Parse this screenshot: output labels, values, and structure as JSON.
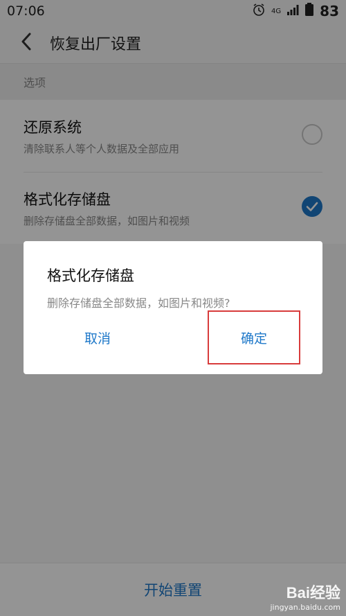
{
  "status_bar": {
    "time": "07:06",
    "network": "4G",
    "battery": "83"
  },
  "header": {
    "title": "恢复出厂设置"
  },
  "section": {
    "label": "选项"
  },
  "options": [
    {
      "title": "还原系统",
      "subtitle": "清除联系人等个人数据及全部应用",
      "checked": false
    },
    {
      "title": "格式化存储盘",
      "subtitle": "删除存储盘全部数据，如图片和视频",
      "checked": true
    }
  ],
  "dialog": {
    "title": "格式化存储盘",
    "message": "删除存储盘全部数据，如图片和视频?",
    "cancel_label": "取消",
    "confirm_label": "确定"
  },
  "bottom": {
    "button_label": "开始重置"
  },
  "watermark": {
    "brand": "Bai经验",
    "url": "jingyan.baidu.com"
  },
  "colors": {
    "accent": "#1e78c9",
    "highlight_box": "#d83b3b"
  }
}
